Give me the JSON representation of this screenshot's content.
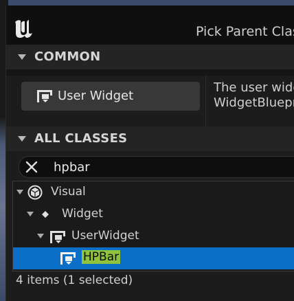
{
  "window": {
    "title": "Pick Parent Class"
  },
  "common": {
    "header": "COMMON",
    "button_label": "User Widget",
    "description_line1": "The user widg",
    "description_line2": "WidgetBluepri"
  },
  "all_classes": {
    "header": "ALL CLASSES",
    "search": {
      "value": "hpbar",
      "placeholder": ""
    },
    "tree": [
      {
        "label": "Visual",
        "icon": "cube-icon",
        "expanded": true
      },
      {
        "label": "Widget",
        "icon": "diamond-icon",
        "expanded": true
      },
      {
        "label": "UserWidget",
        "icon": "user-widget-icon",
        "expanded": true
      },
      {
        "label": "HPBar",
        "icon": "user-widget-icon",
        "selected": true
      }
    ],
    "status": "4 items (1 selected)"
  },
  "colors": {
    "selection": "#0c6fc7",
    "match_highlight": "#8fc23d"
  }
}
